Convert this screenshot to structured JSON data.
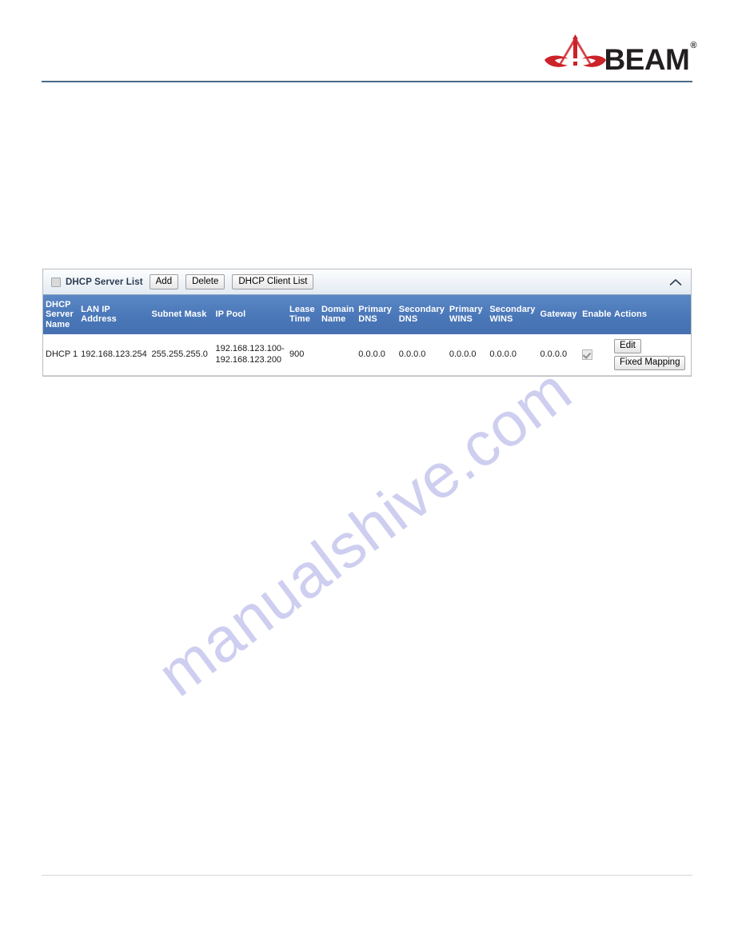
{
  "brand": {
    "logo_text": "BEAM",
    "registered_mark": "®",
    "logo_icon_name": "beam-antenna-logo",
    "logo_color": "#cc2229",
    "text_color": "#231f20"
  },
  "watermark": {
    "text": "manualshive.com",
    "color": "#ccccf0"
  },
  "panel": {
    "title": "DHCP Server List",
    "select_all_checkbox": "",
    "collapse_icon": "chevron-up-icon",
    "buttons": [
      {
        "label": "Add",
        "name": "add-button"
      },
      {
        "label": "Delete",
        "name": "delete-button"
      },
      {
        "label": "DHCP Client List",
        "name": "dhcp-client-list-button"
      }
    ]
  },
  "table": {
    "columns": [
      {
        "key": "dhcp_server_name",
        "label": "DHCP Server Name"
      },
      {
        "key": "lan_ip_address",
        "label": "LAN IP Address"
      },
      {
        "key": "subnet_mask",
        "label": "Subnet Mask"
      },
      {
        "key": "ip_pool",
        "label": "IP Pool"
      },
      {
        "key": "lease_time",
        "label": "Lease Time"
      },
      {
        "key": "domain_name",
        "label": "Domain Name"
      },
      {
        "key": "primary_dns",
        "label": "Primary DNS"
      },
      {
        "key": "secondary_dns",
        "label": "Secondary DNS"
      },
      {
        "key": "primary_wins",
        "label": "Primary WINS"
      },
      {
        "key": "secondary_wins",
        "label": "Secondary WINS"
      },
      {
        "key": "gateway",
        "label": "Gateway"
      },
      {
        "key": "enable",
        "label": "Enable"
      },
      {
        "key": "actions",
        "label": "Actions"
      }
    ],
    "rows": [
      {
        "dhcp_server_name": "DHCP 1",
        "lan_ip_address": "192.168.123.254",
        "subnet_mask": "255.255.255.0",
        "ip_pool": "192.168.123.100-192.168.123.200",
        "lease_time": "900",
        "domain_name": "",
        "primary_dns": "0.0.0.0",
        "secondary_dns": "0.0.0.0",
        "primary_wins": "0.0.0.0",
        "secondary_wins": "0.0.0.0",
        "gateway": "0.0.0.0",
        "enable_checked": true,
        "actions": {
          "edit_label": "Edit",
          "fixed_mapping_label": "Fixed Mapping"
        }
      }
    ]
  },
  "colors": {
    "table_header_blue": "#4a77b8",
    "panel_border": "#b9bcc0",
    "header_rule": "#4a6a86",
    "footer_rule": "#d7d7d7"
  }
}
